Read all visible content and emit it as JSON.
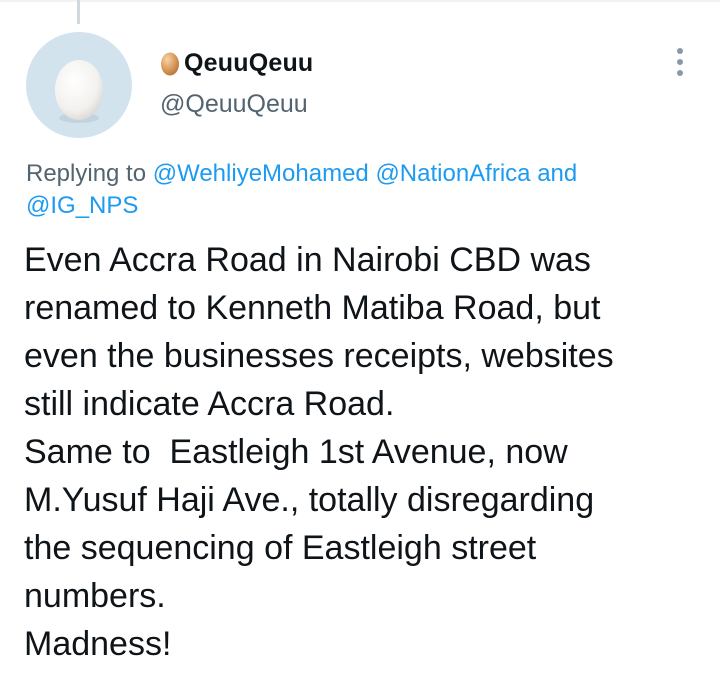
{
  "colors": {
    "link": "#1d9bf0",
    "secondary_text": "#536471",
    "primary_text": "#0f1419",
    "avatar_bg": "#d3e3ee"
  },
  "author": {
    "emoji_icon": "egg-emoji",
    "display_name": "QeuuQeuu",
    "handle": "@QeuuQeuu",
    "avatar_icon": "egg-avatar"
  },
  "more_icon": "more-vertical-icon",
  "reply_context": {
    "prefix": "Replying to ",
    "mentions": [
      "@WehliyeMohamed",
      "@NationAfrica"
    ],
    "conjunction": " and ",
    "last_mention": "@IG_NPS"
  },
  "tweet": {
    "lines": [
      "Even Accra Road in Nairobi CBD was",
      "renamed to Kenneth Matiba Road, but",
      "even the businesses receipts, websites",
      "still indicate Accra Road.",
      "Same to  Eastleigh 1st Avenue, now",
      "M.Yusuf Haji Ave., totally disregarding",
      "the sequencing of Eastleigh street",
      "numbers.",
      "Madness!"
    ]
  }
}
